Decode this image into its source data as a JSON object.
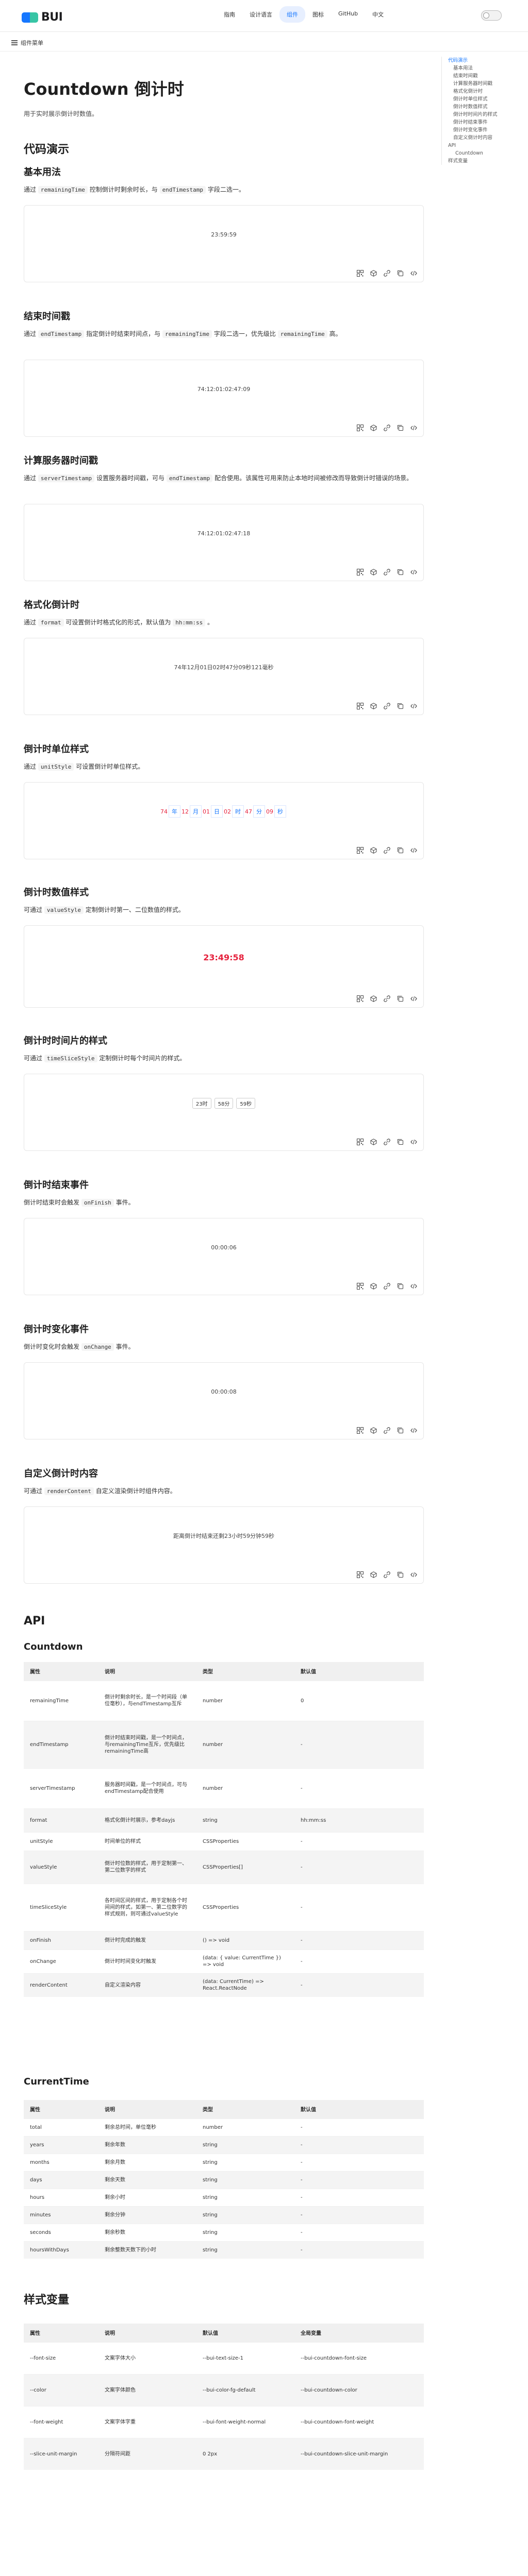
{
  "header": {
    "logo_text": "BUI",
    "nav": [
      "指南",
      "设计语言",
      "组件",
      "图标",
      "GitHub",
      "中文"
    ],
    "active_nav": "组件"
  },
  "subbar": {
    "menu_label": "组件菜单"
  },
  "toc": {
    "items": [
      {
        "label": "代码演示",
        "level": 1,
        "active": true
      },
      {
        "label": "基本用法",
        "level": 2
      },
      {
        "label": "结束时间戳",
        "level": 2
      },
      {
        "label": "计算服务器时间戳",
        "level": 2
      },
      {
        "label": "格式化倒计时",
        "level": 2
      },
      {
        "label": "倒计时单位样式",
        "level": 2
      },
      {
        "label": "倒计时数值样式",
        "level": 2
      },
      {
        "label": "倒计时时间片的样式",
        "level": 2
      },
      {
        "label": "倒计时结束事件",
        "level": 2
      },
      {
        "label": "倒计时变化事件",
        "level": 2
      },
      {
        "label": "自定义倒计时内容",
        "level": 2
      },
      {
        "label": "API",
        "level": 1
      },
      {
        "label": "Countdown",
        "level": 3
      },
      {
        "label": "样式变量",
        "level": 1
      }
    ]
  },
  "page": {
    "title": "Countdown 倒计时",
    "intro": "用于实时展示倒计时数值。",
    "demo_heading": "代码演示"
  },
  "demos": [
    {
      "title": "基本用法",
      "desc": [
        {
          "t": "通过 "
        },
        {
          "c": "remainingTime"
        },
        {
          "t": " 控制倒计时剩余时长，与 "
        },
        {
          "c": "endTimestamp"
        },
        {
          "t": " 字段二选一。"
        }
      ],
      "preview": "23:59:59"
    },
    {
      "title": "结束时间戳",
      "desc": [
        {
          "t": "通过 "
        },
        {
          "c": "endTimestamp"
        },
        {
          "t": " 指定倒计时结束时间点，与 "
        },
        {
          "c": "remainingTime"
        },
        {
          "t": " 字段二选一，优先级比 "
        },
        {
          "c": "remainingTime"
        },
        {
          "t": " 高。"
        }
      ],
      "preview": "74:12:01:02:47:09"
    },
    {
      "title": "计算服务器时间戳",
      "desc": [
        {
          "t": "通过 "
        },
        {
          "c": "serverTimestamp"
        },
        {
          "t": " 设置服务器时间戳，可与 "
        },
        {
          "c": "endTimestamp"
        },
        {
          "t": " 配合使用。该属性可用来防止本地时间被修改而导致倒计时错误的场景。"
        }
      ],
      "preview": "74:12:01:02:47:18"
    },
    {
      "title": "格式化倒计时",
      "desc": [
        {
          "t": "通过 "
        },
        {
          "c": "format"
        },
        {
          "t": " 可设置倒计时格式化的形式，默认值为 "
        },
        {
          "c": "hh:mm:ss"
        },
        {
          "t": " 。"
        }
      ],
      "preview": "74年12月01日02时47分09秒121毫秒"
    },
    {
      "title": "倒计时单位样式",
      "desc": [
        {
          "t": "通过 "
        },
        {
          "c": "unitStyle"
        },
        {
          "t": " 可设置倒计时单位样式。"
        }
      ],
      "preview_segments": [
        "74",
        "年",
        "12",
        "月",
        "01",
        "日",
        "02",
        "时",
        "47",
        "分",
        "09",
        "秒"
      ]
    },
    {
      "title": "倒计时数值样式",
      "desc": [
        {
          "t": "可通过 "
        },
        {
          "c": "valueStyle"
        },
        {
          "t": " 定制倒计时第一、二位数值的样式。"
        }
      ],
      "preview": "23:49:58"
    },
    {
      "title": "倒计时时间片的样式",
      "desc": [
        {
          "t": "可通过 "
        },
        {
          "c": "timeSliceStyle"
        },
        {
          "t": " 定制倒计时每个时间片的样式。"
        }
      ],
      "preview_slices": [
        "23时",
        "58分",
        "59秒"
      ]
    },
    {
      "title": "倒计时结束事件",
      "desc": [
        {
          "t": "倒计时结束时会触发 "
        },
        {
          "c": "onFinish"
        },
        {
          "t": " 事件。"
        }
      ],
      "preview": "00:00:06"
    },
    {
      "title": "倒计时变化事件",
      "desc": [
        {
          "t": "倒计时变化时会触发 "
        },
        {
          "c": "onChange"
        },
        {
          "t": " 事件。"
        }
      ],
      "preview": "00:00:08"
    },
    {
      "title": "自定义倒计时内容",
      "desc": [
        {
          "t": "可通过 "
        },
        {
          "c": "renderContent"
        },
        {
          "t": " 自定义渲染倒计时组件内容。"
        }
      ],
      "preview": "距离倒计时结束还剩23小时59分钟59秒"
    }
  ],
  "api": {
    "heading": "API",
    "countdown_heading": "Countdown",
    "headers": [
      "属性",
      "说明",
      "类型",
      "默认值"
    ],
    "rows": [
      [
        "remainingTime",
        "倒计时剩余时长，是一个时间段（单位毫秒），与endTimestamp互斥",
        "number",
        "0"
      ],
      [
        "endTimestamp",
        "倒计时结束时间戳，是一个时间点，与remainingTime互斥，优先级比remainingTime高",
        "number",
        "-"
      ],
      [
        "serverTimestamp",
        "服务器时间戳，是一个时间点，可与endTimestamp配合使用",
        "number",
        "-"
      ],
      [
        "format",
        "格式化倒计时展示，参考dayjs",
        "string",
        "hh:mm:ss"
      ],
      [
        "unitStyle",
        "时间单位的样式",
        "CSSProperties",
        "-"
      ],
      [
        "valueStyle",
        "倒计时位数的样式，用于定制第一、第二位数字的样式",
        "CSSProperties[]",
        "-"
      ],
      [
        "timeSliceStyle",
        "各时间区间的样式，用于定制各个时间间的样式，如第一、第二位数字的样式规则，则可通过valueStyle",
        "CSSProperties",
        "-"
      ],
      [
        "onFinish",
        "倒计时完成的触发",
        "() => void",
        "-"
      ],
      [
        "onChange",
        "倒计时时间变化时触发",
        "(data: { value: CurrentTime }) => void",
        "-"
      ],
      [
        "renderContent",
        "自定义渲染内容",
        "(data: CurrentTime) => React.ReactNode",
        "-"
      ]
    ],
    "current_heading": "CurrentTime",
    "current_headers": [
      "属性",
      "说明",
      "类型",
      "默认值"
    ],
    "current_rows": [
      [
        "total",
        "剩余总时间，单位毫秒",
        "number",
        "-"
      ],
      [
        "years",
        "剩余年数",
        "string",
        "-"
      ],
      [
        "months",
        "剩余月数",
        "string",
        "-"
      ],
      [
        "days",
        "剩余天数",
        "string",
        "-"
      ],
      [
        "hours",
        "剩余小时",
        "string",
        "-"
      ],
      [
        "minutes",
        "剩余分钟",
        "string",
        "-"
      ],
      [
        "seconds",
        "剩余秒数",
        "string",
        "-"
      ],
      [
        "hoursWithDays",
        "剩余整数天数下的小时",
        "string",
        "-"
      ]
    ]
  },
  "style_vars": {
    "heading": "样式变量",
    "headers": [
      "属性",
      "说明",
      "默认值",
      "全局变量"
    ],
    "rows": [
      [
        "--font-size",
        "文案字体大小",
        "--bui-text-size-1",
        "--bui-countdown-font-size"
      ],
      [
        "--color",
        "文案字体颜色",
        "--bui-color-fg-default",
        "--bui-countdown-color"
      ],
      [
        "--font-weight",
        "文案字体字重",
        "--bui-font-weight-normal",
        "--bui-countdown-font-weight"
      ],
      [
        "--slice-unit-margin",
        "分隔符间距",
        "0 2px",
        "--bui-countdown-slice-unit-margin"
      ]
    ]
  },
  "colors": {
    "accent": "#1677ff",
    "red": "#e6223d",
    "brand_green": "#37c5a5"
  }
}
